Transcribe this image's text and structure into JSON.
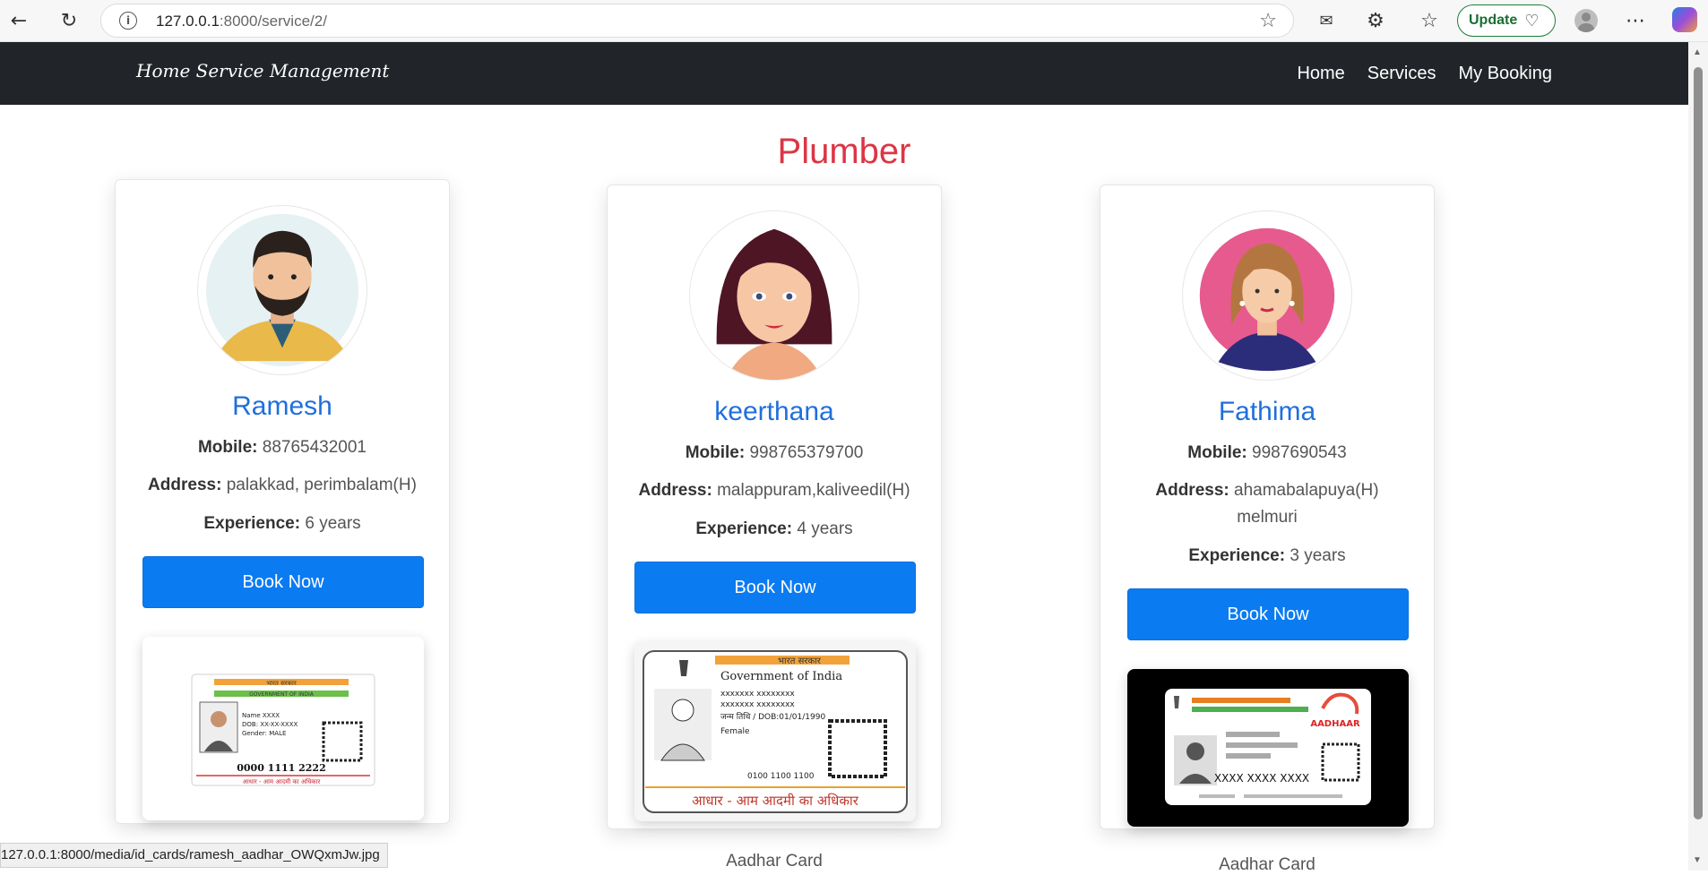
{
  "browser": {
    "url_host": "127.0.0.1",
    "url_rest": ":8000/service/2/",
    "update_label": "Update"
  },
  "navbar": {
    "brand": "Home Service Management",
    "links": [
      "Home",
      "Services",
      "My Booking"
    ]
  },
  "page": {
    "title": "Plumber"
  },
  "labels": {
    "mobile": "Mobile:",
    "address": "Address:",
    "experience": "Experience:",
    "book": "Book Now",
    "id_caption": "Aadhar Card"
  },
  "providers": [
    {
      "name": "Ramesh",
      "mobile": "88765432001",
      "address": "palakkad, perimbalam(H)",
      "experience": "6 years"
    },
    {
      "name": "keerthana",
      "mobile": "998765379700",
      "address": "malappuram,kaliveedil(H)",
      "experience": "4 years"
    },
    {
      "name": "Fathima",
      "mobile": "9987690543",
      "address_line1": "ahamabalapuya(H)",
      "address_line2": "melmuri",
      "experience": "3 years"
    }
  ],
  "id_cards": {
    "card1": {
      "gov_hindi": "भारत सरकार",
      "gov": "GOVERNMENT OF INDIA",
      "name": "Name XXXX",
      "dob": "DOB: XX-XX-XXXX",
      "gender": "Gender: MALE",
      "number": "0000 1111 2222",
      "slogan": "आधार - आम आदमी का अधिकार"
    },
    "card2": {
      "gov_hindi": "भारत सरकार",
      "gov": "Government of India",
      "l1": "xxxxxxx xxxxxxxx",
      "l2": "xxxxxxx xxxxxxxx",
      "dob": "जन्म तिथि / DOB:01/01/1990",
      "gender": "Female",
      "number": "0100 1100 1100",
      "slogan": "आधार - आम आदमी का अधिकार"
    },
    "card3": {
      "brand": "AADHAAR",
      "number": "XXXX XXXX XXXX"
    }
  },
  "statusbar": {
    "text": "127.0.0.1:8000/media/id_cards/ramesh_aadhar_OWQxmJw.jpg"
  }
}
